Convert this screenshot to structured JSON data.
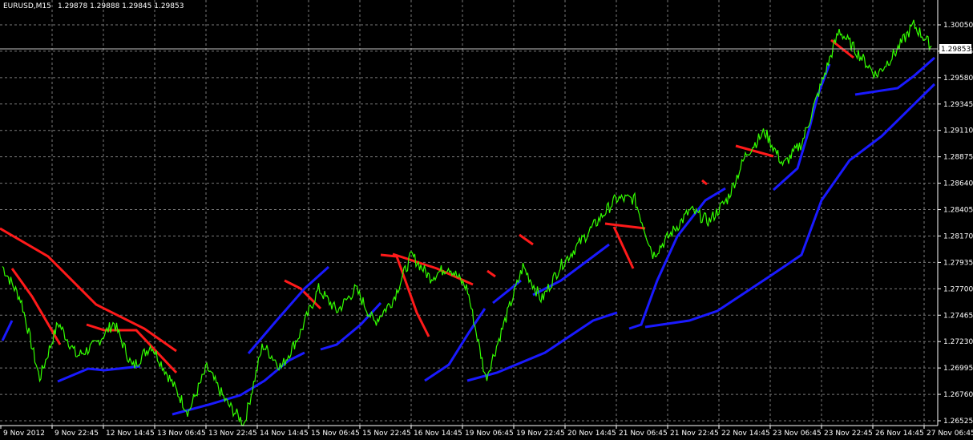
{
  "header": {
    "symbol_text": "EURUSD,M15",
    "ohlc_text": "1.29878 1.29888 1.29845 1.29853"
  },
  "price_scale": {
    "ticks": [
      "1.30050",
      "1.29815",
      "1.29580",
      "1.29345",
      "1.29110",
      "1.28875",
      "1.28640",
      "1.28405",
      "1.28170",
      "1.27935",
      "1.27700",
      "1.27465",
      "1.27230",
      "1.26995",
      "1.26760",
      "1.26525"
    ],
    "current_price": "1.29853"
  },
  "time_scale": {
    "ticks": [
      "9 Nov 2012",
      "9 Nov 22:45",
      "12 Nov 14:45",
      "13 Nov 06:45",
      "13 Nov 22:45",
      "14 Nov 14:45",
      "15 Nov 06:45",
      "15 Nov 22:45",
      "16 Nov 14:45",
      "19 Nov 06:45",
      "19 Nov 22:45",
      "20 Nov 14:45",
      "21 Nov 06:45",
      "21 Nov 22:45",
      "22 Nov 14:45",
      "23 Nov 06:45",
      "23 Nov 22:45",
      "26 Nov 14:45",
      "27 Nov 06:45"
    ]
  },
  "colors": {
    "background": "#000000",
    "grid": "#7a7a7a",
    "price_line": "#33ff00",
    "band_upper": "#ff1a1a",
    "band_lower": "#1a1aff",
    "text": "#ffffff"
  },
  "chart_data": {
    "type": "line",
    "title": "EURUSD,M15",
    "x_range": [
      "9 Nov 2012",
      "27 Nov 06:45"
    ],
    "ylim": [
      1.26525,
      1.3015
    ],
    "grid": true,
    "series": [
      {
        "name": "EURUSD,M15",
        "values": [
          1.279,
          1.276,
          1.269,
          1.274,
          1.271,
          1.272,
          1.274,
          1.27,
          1.272,
          1.269,
          1.266,
          1.27,
          1.267,
          1.265,
          1.272,
          1.27,
          1.273,
          1.277,
          1.275,
          1.277,
          1.274,
          1.276,
          1.28,
          1.278,
          1.279,
          1.277,
          1.269,
          1.274,
          1.279,
          1.276,
          1.279,
          1.281,
          1.283,
          1.285,
          1.285,
          1.28,
          1.282,
          1.284,
          1.283,
          1.285,
          1.289,
          1.291,
          1.288,
          1.29,
          1.295,
          1.3,
          1.298,
          1.296,
          1.298,
          1.3005,
          1.2985
        ]
      }
    ]
  }
}
